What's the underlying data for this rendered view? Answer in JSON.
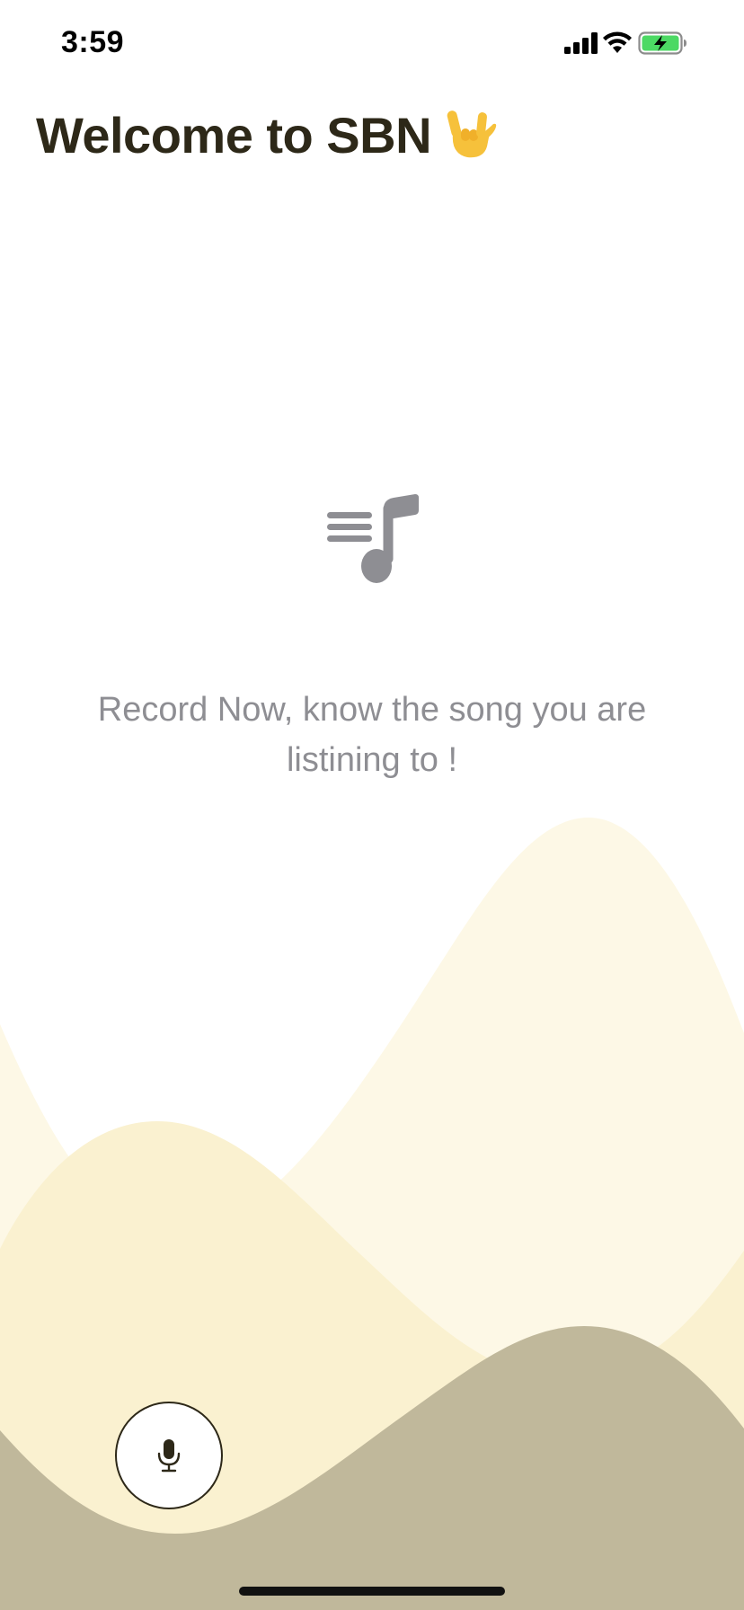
{
  "status_bar": {
    "time": "3:59",
    "icons": [
      "cellular-signal-icon",
      "wifi-icon",
      "battery-charging-icon"
    ],
    "battery_color": "#4cd964"
  },
  "header": {
    "title": "Welcome to SBN",
    "emoji": "love-you-gesture-emoji"
  },
  "empty_state": {
    "icon": "music-playlist-icon",
    "message": "Record Now, know the song you are listining to !"
  },
  "record_button": {
    "icon": "microphone-icon"
  },
  "colors": {
    "title": "#2d2818",
    "message": "#8e8e93",
    "icon_gray": "#8e8e93",
    "wave_light": "#fdf8e6",
    "wave_mid": "#faf1d0",
    "wave_dark": "#c0b89b"
  }
}
